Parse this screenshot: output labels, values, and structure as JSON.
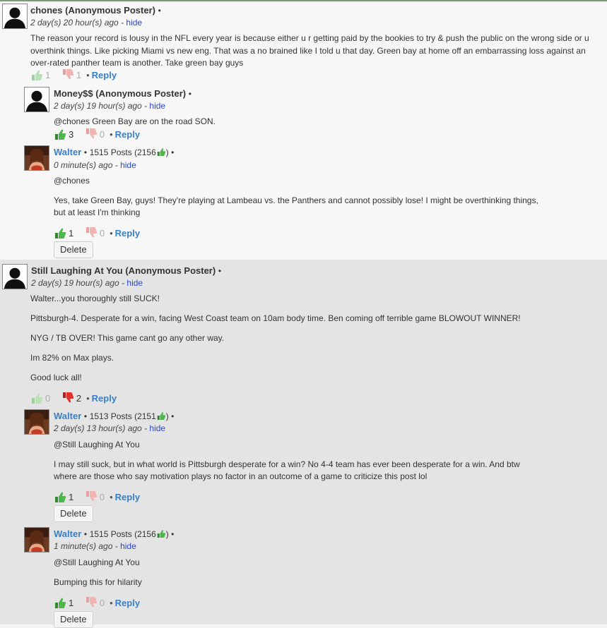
{
  "comments": [
    {
      "author": "chones (Anonymous Poster)",
      "sep": "•",
      "time": "2 day(s) 20 hour(s) ago",
      "dash": "-",
      "hide": "hide",
      "lines": [
        "The reason your record is lousy in the NFL every year is because either u r getting paid by the bookies to try & push the public on the wrong side or u",
        "overthink things. Like picking Miami vs new eng. That was a no brained like I told u that day. Green bay at home off an embarrassing loss against an",
        "over-rated panther team is another. Take green bay guys"
      ],
      "up": "1",
      "down": "1",
      "dot": "•",
      "reply": "Reply"
    },
    {
      "author": "Money$$ (Anonymous Poster)",
      "sep": "•",
      "time": "2 day(s) 19 hour(s) ago",
      "dash": "-",
      "hide": "hide",
      "lines": [
        "@chones Green Bay are on the road SON."
      ],
      "up": "3",
      "down": "0",
      "dot": "•",
      "reply": "Reply"
    },
    {
      "author": "Walter",
      "sep": "•",
      "posts_pre": "1515 Posts (2156",
      "posts_post": ") •",
      "time": "0 minute(s) ago",
      "dash": "-",
      "hide": "hide",
      "lines": [
        "@chones",
        "Yes, take Green Bay, guys! They're playing at Lambeau vs. the Panthers and cannot possibly lose! I might be overthinking things,",
        "but at least I'm thinking"
      ],
      "up": "1",
      "down": "0",
      "dot": "•",
      "reply": "Reply",
      "delete": "Delete"
    },
    {
      "author": "Still Laughing At You (Anonymous Poster)",
      "sep": "•",
      "time": "2 day(s) 19 hour(s) ago",
      "dash": "-",
      "hide": "hide",
      "lines": [
        "Walter...you thoroughly still SUCK!",
        "Pittsburgh-4. Desperate for a win, facing West Coast team on 10am body time. Ben coming off terrible game BLOWOUT WINNER!",
        "NYG / TB OVER! This game cant go any other way.",
        "Im 82% on Max plays.",
        "Good luck all!"
      ],
      "up": "0",
      "down": "2",
      "dot": "•",
      "reply": "Reply"
    },
    {
      "author": "Walter",
      "sep": "•",
      "posts_pre": "1513 Posts (2151",
      "posts_post": ") •",
      "time": "2 day(s) 13 hour(s) ago",
      "dash": "-",
      "hide": "hide",
      "lines": [
        "@Still Laughing At You",
        "I may still suck, but in what world is Pittsburgh desperate for a win? No 4-4 team has ever been desperate for a win. And btw",
        "where are those who say motivation plays no factor in an outcome of a game to criticize this post lol"
      ],
      "up": "1",
      "down": "0",
      "dot": "•",
      "reply": "Reply",
      "delete": "Delete"
    },
    {
      "author": "Walter",
      "sep": "•",
      "posts_pre": "1515 Posts (2156",
      "posts_post": ") •",
      "time": "1 minute(s) ago",
      "dash": "-",
      "hide": "hide",
      "lines": [
        "@Still Laughing At You",
        "Bumping this for hilarity"
      ],
      "up": "1",
      "down": "0",
      "dot": "•",
      "reply": "Reply",
      "delete": "Delete"
    }
  ],
  "colors": {
    "link": "#3a7fc4",
    "hide_link": "#2b47c7",
    "thumb_up": "#3fa33f",
    "thumb_down": "#d9231f",
    "thread_bg_1": "#f7f7f7",
    "thread_bg_2": "#e4e4e4"
  },
  "icons": {
    "anon_avatar": "silhouette-avatar",
    "walter_avatar": "walter-photo-avatar",
    "up": "thumbs-up-icon",
    "down": "thumbs-down-icon"
  }
}
